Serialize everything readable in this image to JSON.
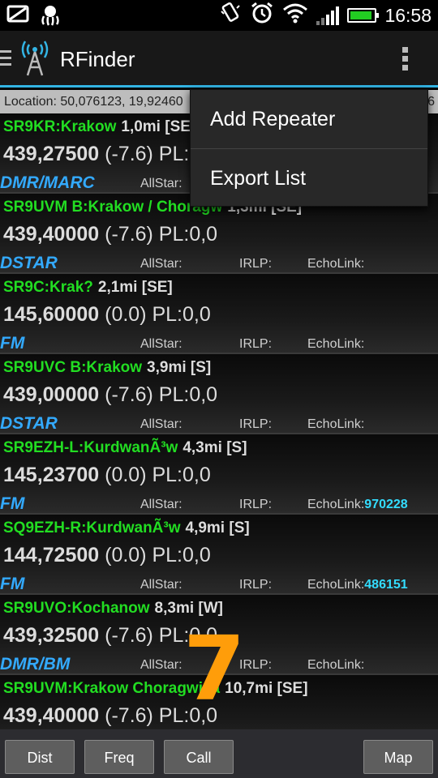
{
  "status_bar": {
    "left_icons": [
      "screenshot-icon",
      "octopus-icon"
    ],
    "right_icons": [
      "vibrate-icon",
      "alarm-icon",
      "wifi-icon",
      "signal-icon",
      "battery-icon"
    ],
    "time": "16:58",
    "battery_level": 0.9
  },
  "app_bar": {
    "title": "RFinder",
    "overflow_icon": "overflow-menu-icon"
  },
  "location": {
    "text": "Location: 50,076123, 19,92460",
    "trailing": "6"
  },
  "popup_menu": {
    "items": [
      "Add Repeater",
      "Export List"
    ]
  },
  "repeaters": [
    {
      "call": "SR9KR:Krakow",
      "dist": "1,0mi [SE]",
      "freq": "439,27500",
      "offset_pl": " (-7.6) PL:0,0",
      "mode": "DMR/MARC",
      "allstar": "AllStar:",
      "irlp": "IRLP:",
      "echolink": "EchoLink:",
      "echolink_num": ""
    },
    {
      "call": "SR9UVM B:Krakow / Choragw",
      "dist": "1,3mi [SE]",
      "freq": "439,40000",
      "offset_pl": " (-7.6) PL:0,0",
      "mode": "DSTAR",
      "allstar": "AllStar:",
      "irlp": "IRLP:",
      "echolink": "EchoLink:",
      "echolink_num": ""
    },
    {
      "call": "SR9C:Krak?",
      "dist": "2,1mi [SE]",
      "freq": "145,60000",
      "offset_pl": " (0.0) PL:0,0",
      "mode": "FM",
      "allstar": "AllStar:",
      "irlp": "IRLP:",
      "echolink": "EchoLink:",
      "echolink_num": ""
    },
    {
      "call": "SR9UVC B:Krakow",
      "dist": "3,9mi [S]",
      "freq": "439,00000",
      "offset_pl": " (-7.6) PL:0,0",
      "mode": "DSTAR",
      "allstar": "AllStar:",
      "irlp": "IRLP:",
      "echolink": "EchoLink:",
      "echolink_num": ""
    },
    {
      "call": "SR9EZH-L:KurdwanÃ³w",
      "dist": "4,3mi [S]",
      "freq": "145,23700",
      "offset_pl": " (0.0) PL:0,0",
      "mode": "FM",
      "allstar": "AllStar:",
      "irlp": "IRLP:",
      "echolink": "EchoLink:",
      "echolink_num": "970228"
    },
    {
      "call": "SQ9EZH-R:KurdwanÃ³w",
      "dist": "4,9mi [S]",
      "freq": "144,72500",
      "offset_pl": " (0.0) PL:0,0",
      "mode": "FM",
      "allstar": "AllStar:",
      "irlp": "IRLP:",
      "echolink": "EchoLink:",
      "echolink_num": "486151"
    },
    {
      "call": "SR9UVO:Kochanow",
      "dist": "8,3mi [W]",
      "freq": "439,32500",
      "offset_pl": " (-7.6) PL:0,0",
      "mode": "DMR/BM",
      "allstar": "AllStar:",
      "irlp": "IRLP:",
      "echolink": "EchoLink:",
      "echolink_num": ""
    },
    {
      "call": "SR9UVM:Krakow Choragwica",
      "dist": "10,7mi [SE]",
      "freq": "439,40000",
      "offset_pl": " (-7.6) PL:0,0",
      "mode": "",
      "allstar": "",
      "irlp": "",
      "echolink": "",
      "echolink_num": ""
    }
  ],
  "overlay_number": "7",
  "bottom_buttons": {
    "dist": "Dist",
    "freq": "Freq",
    "call": "Call",
    "map": "Map"
  },
  "colors": {
    "accent": "#33b5e5",
    "callsign": "#22dd22",
    "mode": "#33aaff",
    "echolink_number": "#33ddff",
    "overlay": "#ff9d0a"
  }
}
